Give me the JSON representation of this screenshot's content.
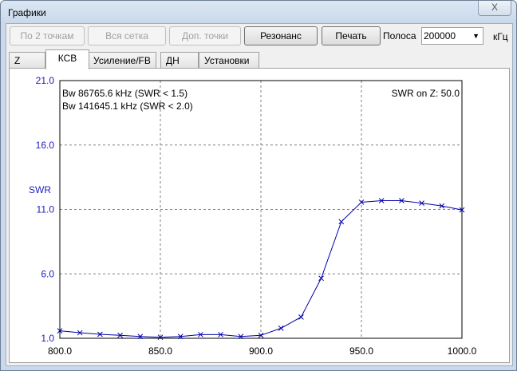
{
  "window": {
    "title": "Графики",
    "close_label": "X"
  },
  "toolbar": {
    "btn_two_points": "По 2 точкам",
    "btn_full_grid": "Вся сетка",
    "btn_extra_points": "Доп. точки",
    "btn_resonance": "Резонанс",
    "btn_print": "Печать",
    "band_label": "Полоса",
    "band_value": "200000",
    "band_unit": "кГц"
  },
  "tabs": [
    "Z",
    "КСВ",
    "Усиление/FB",
    "ДН",
    "Установки"
  ],
  "chart_data": {
    "type": "line",
    "ylabel": "SWR",
    "xlim": [
      800,
      1000
    ],
    "ylim": [
      1,
      21
    ],
    "xticks": [
      "800.0",
      "850.0",
      "900.0",
      "950.0",
      "1000.0"
    ],
    "yticks": [
      "21.0",
      "16.0",
      "11.0",
      "6.0",
      "1.0"
    ],
    "annotations": [
      "Bw 86765.6 kHz (SWR < 1.5)",
      "Bw 141645.1 kHz (SWR < 2.0)",
      "SWR on Z: 50.0"
    ],
    "grid": true,
    "color": "#0000aa",
    "x": [
      800,
      810,
      820,
      830,
      840,
      850,
      860,
      870,
      880,
      890,
      900,
      910,
      920,
      930,
      940,
      950,
      960,
      970,
      980,
      990,
      1000
    ],
    "y": [
      1.58,
      1.43,
      1.31,
      1.23,
      1.14,
      1.08,
      1.14,
      1.29,
      1.29,
      1.14,
      1.23,
      1.78,
      2.65,
      5.66,
      10.05,
      11.56,
      11.68,
      11.68,
      11.49,
      11.27,
      10.96
    ]
  }
}
